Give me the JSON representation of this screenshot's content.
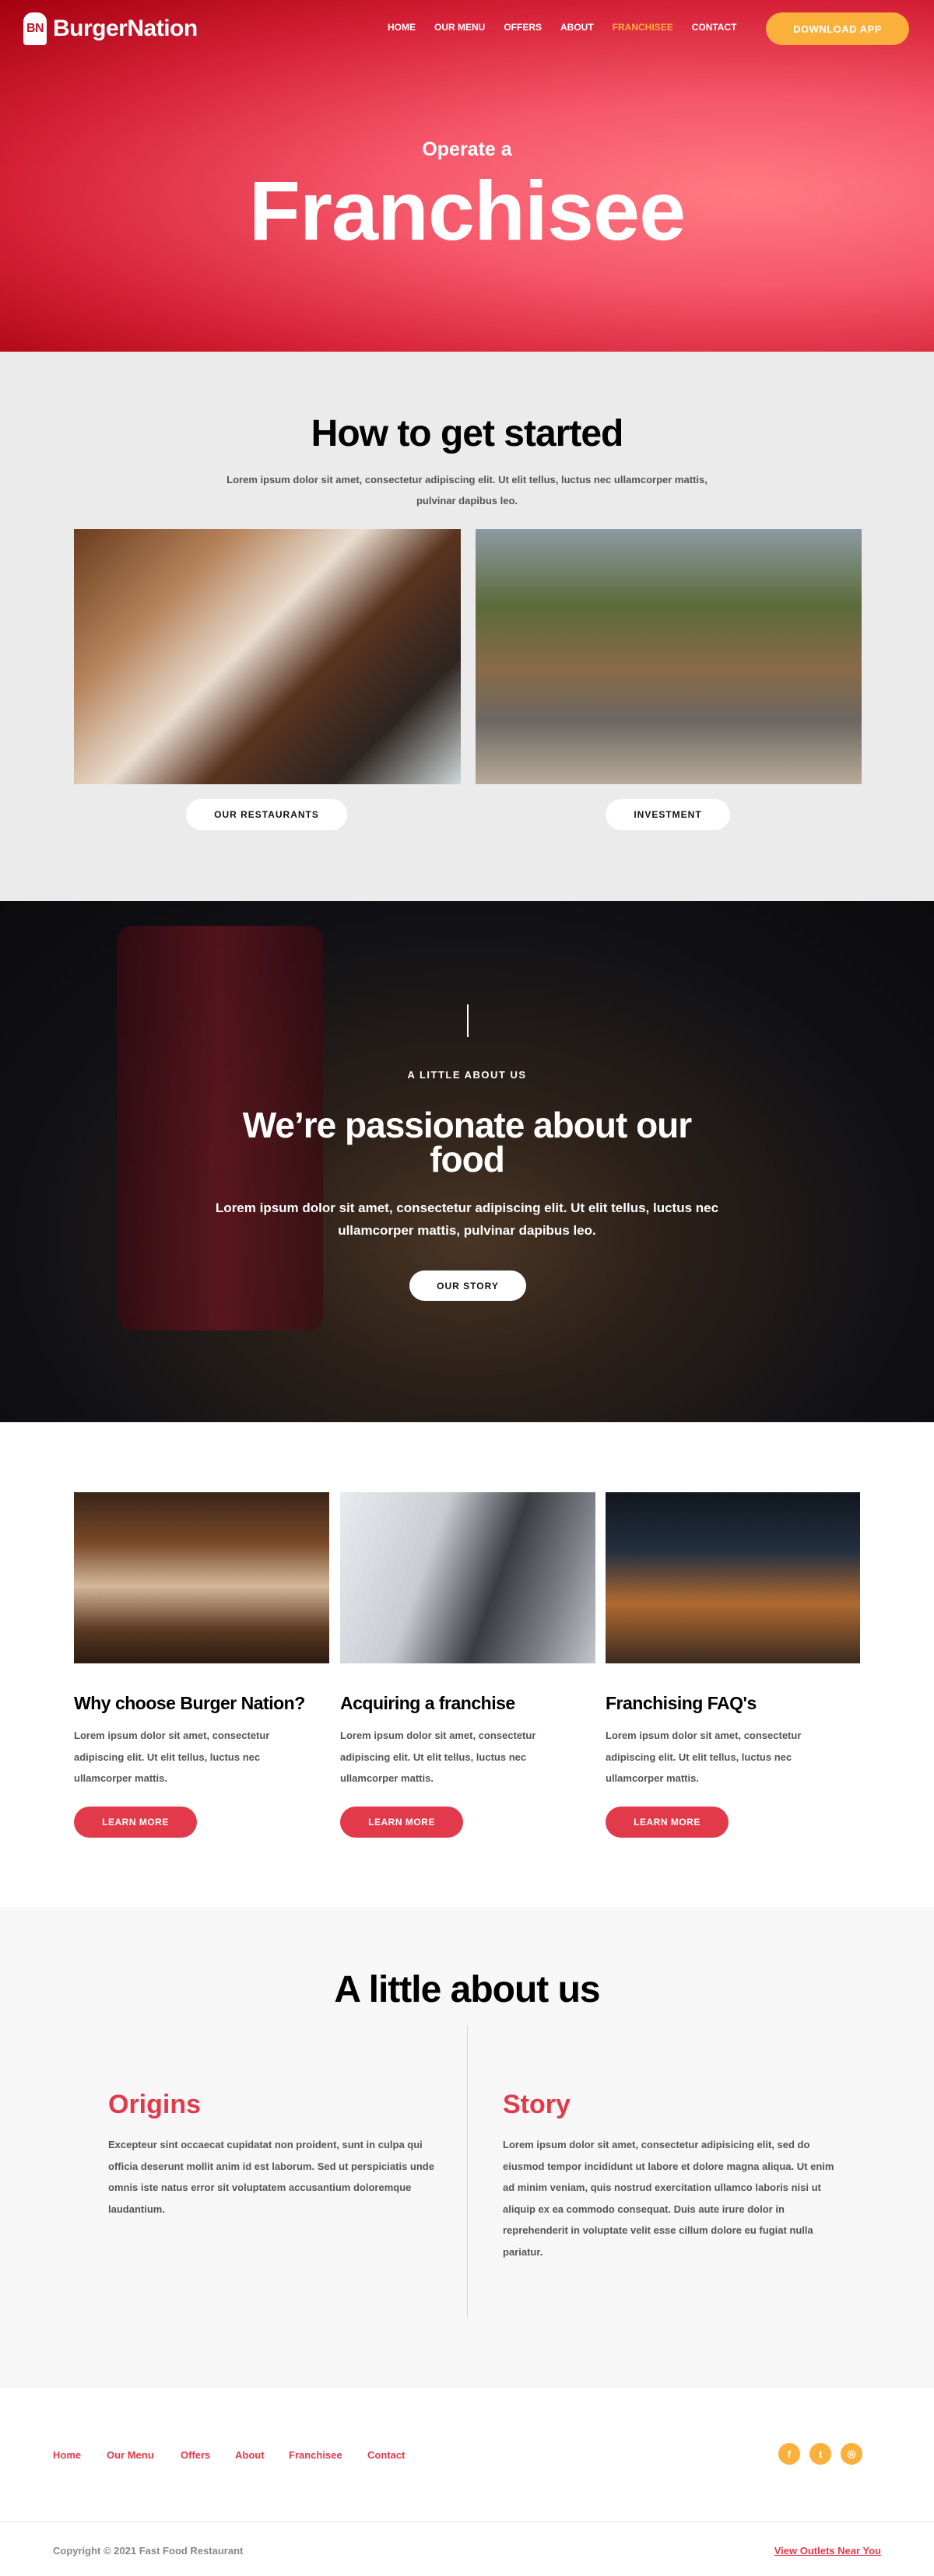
{
  "header": {
    "logo_mark": "BN",
    "logo_text": "BurgerNation",
    "nav": [
      "HOME",
      "OUR MENU",
      "OFFERS",
      "ABOUT",
      "FRANCHISEE",
      "CONTACT"
    ],
    "active_nav": "FRANCHISEE",
    "cta": "DOWNLOAD APP"
  },
  "hero": {
    "subtitle": "Operate a",
    "title": "Franchisee"
  },
  "get_started": {
    "title": "How to get started",
    "text": "Lorem ipsum dolor sit amet, consectetur adipiscing elit. Ut elit tellus, luctus nec ullamcorper mattis, pulvinar dapibus leo.",
    "buttons": [
      "OUR RESTAURANTS",
      "INVESTMENT"
    ]
  },
  "about_banner": {
    "eyebrow": "A LITTLE ABOUT US",
    "title": "We’re passionate about our food",
    "text": "Lorem ipsum dolor sit amet, consectetur adipiscing elit. Ut elit tellus, luctus nec ullamcorper mattis, pulvinar dapibus leo.",
    "button": "OUR STORY"
  },
  "cards": [
    {
      "title": "Why choose Burger Nation?",
      "text": "Lorem ipsum dolor sit amet, consectetur adipiscing elit. Ut elit tellus, luctus nec ullamcorper mattis.",
      "button": "LEARN MORE"
    },
    {
      "title": "Acquiring a franchise",
      "text": "Lorem ipsum dolor sit amet, consectetur adipiscing elit. Ut elit tellus, luctus nec ullamcorper mattis.",
      "button": "LEARN MORE"
    },
    {
      "title": "Franchising FAQ's",
      "text": "Lorem ipsum dolor sit amet, consectetur adipiscing elit. Ut elit tellus, luctus nec ullamcorper mattis.",
      "button": "LEARN MORE"
    }
  ],
  "little_about": {
    "title": "A little about us",
    "origins": {
      "title": "Origins",
      "text": "Excepteur sint occaecat cupidatat non proident, sunt in culpa qui officia deserunt mollit anim id est laborum. Sed ut perspiciatis unde omnis iste natus error sit voluptatem accusantium doloremque laudantium."
    },
    "story": {
      "title": "Story",
      "text": "Lorem ipsum dolor sit amet, consectetur adipisicing elit, sed do eiusmod tempor incididunt ut labore et dolore magna aliqua. Ut enim ad minim veniam, quis nostrud exercitation ullamco laboris nisi ut aliquip ex ea commodo consequat. Duis aute irure dolor in reprehenderit in voluptate velit esse cillum dolore eu fugiat nulla pariatur."
    }
  },
  "footer": {
    "links": [
      "Home",
      "Our Menu",
      "Offers",
      "About",
      "Franchisee",
      "Contact"
    ],
    "social_icons": [
      "facebook-icon",
      "twitter-icon",
      "instagram-icon"
    ],
    "social_glyphs": [
      "f",
      "t",
      "◎"
    ],
    "copyright": "Copyright © 2021 Fast Food Restaurant",
    "outlets_link": "View Outlets Near You"
  },
  "colors": {
    "brand_red": "#e23a4a",
    "accent_orange": "#fbb03b"
  }
}
